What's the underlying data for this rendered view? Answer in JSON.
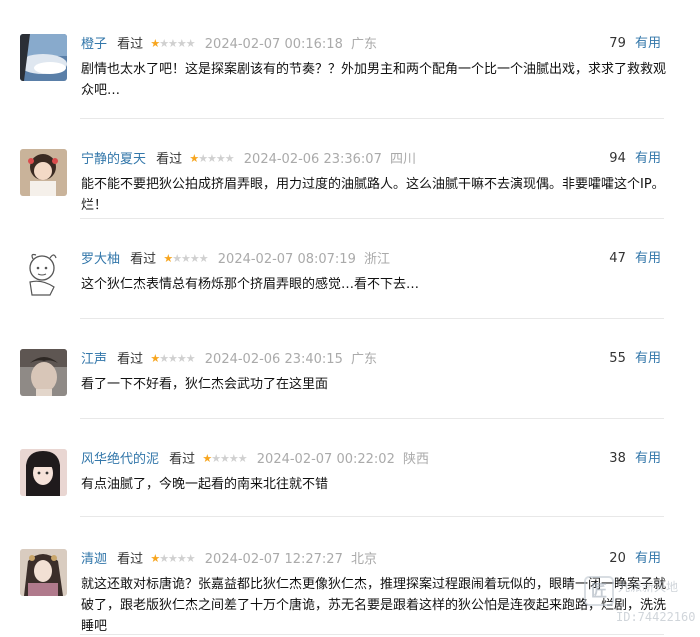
{
  "reviews": [
    {
      "user": "橙子",
      "action": "看过",
      "rating": 1,
      "time": "2024-02-07 00:16:18",
      "location": "广东",
      "votes": "79",
      "useful_label": "有用",
      "content": "剧情也太水了吧！这是探案剧该有的节奏？？外加男主和两个配角一个比一个油腻出戏，求求了救救观众吧…"
    },
    {
      "user": "宁静的夏天",
      "action": "看过",
      "rating": 1,
      "time": "2024-02-06 23:36:07",
      "location": "四川",
      "votes": "94",
      "useful_label": "有用",
      "content": "能不能不要把狄公拍成挤眉弄眼，用力过度的油腻路人。这么油腻干嘛不去演现偶。非要嚯嚯这个IP。烂！"
    },
    {
      "user": "罗大柚",
      "action": "看过",
      "rating": 1,
      "time": "2024-02-07 08:07:19",
      "location": "浙江",
      "votes": "47",
      "useful_label": "有用",
      "content": "这个狄仁杰表情总有杨烁那个挤眉弄眼的感觉…看不下去…"
    },
    {
      "user": "江声",
      "action": "看过",
      "rating": 1,
      "time": "2024-02-06 23:40:15",
      "location": "广东",
      "votes": "55",
      "useful_label": "有用",
      "content": "看了一下不好看，狄仁杰会武功了在这里面"
    },
    {
      "user": "风华绝代的泥",
      "action": "看过",
      "rating": 1,
      "time": "2024-02-07 00:22:02",
      "location": "陕西",
      "votes": "38",
      "useful_label": "有用",
      "content": "有点油腻了，今晚一起看的南来北往就不错"
    },
    {
      "user": "清迦",
      "action": "看过",
      "rating": 1,
      "time": "2024-02-07 12:27:27",
      "location": "北京",
      "votes": "20",
      "useful_label": "有用",
      "content": "就这还敢对标唐诡？张嘉益都比狄仁杰更像狄仁杰，推理探案过程跟闹着玩似的，眼睛一闭一睁案子就破了，跟老版狄仁杰之间差了十万个唐诡，苏无名要是跟着这样的狄公怕是连夜起来跑路，烂剧，洗洗睡吧"
    }
  ],
  "colors": {
    "link": "#3377aa",
    "star": "#f7a51e",
    "muted": "#aaaaaa"
  },
  "watermark": {
    "name": "九派新天地",
    "id": "ID:74422160",
    "logo": "匠"
  }
}
